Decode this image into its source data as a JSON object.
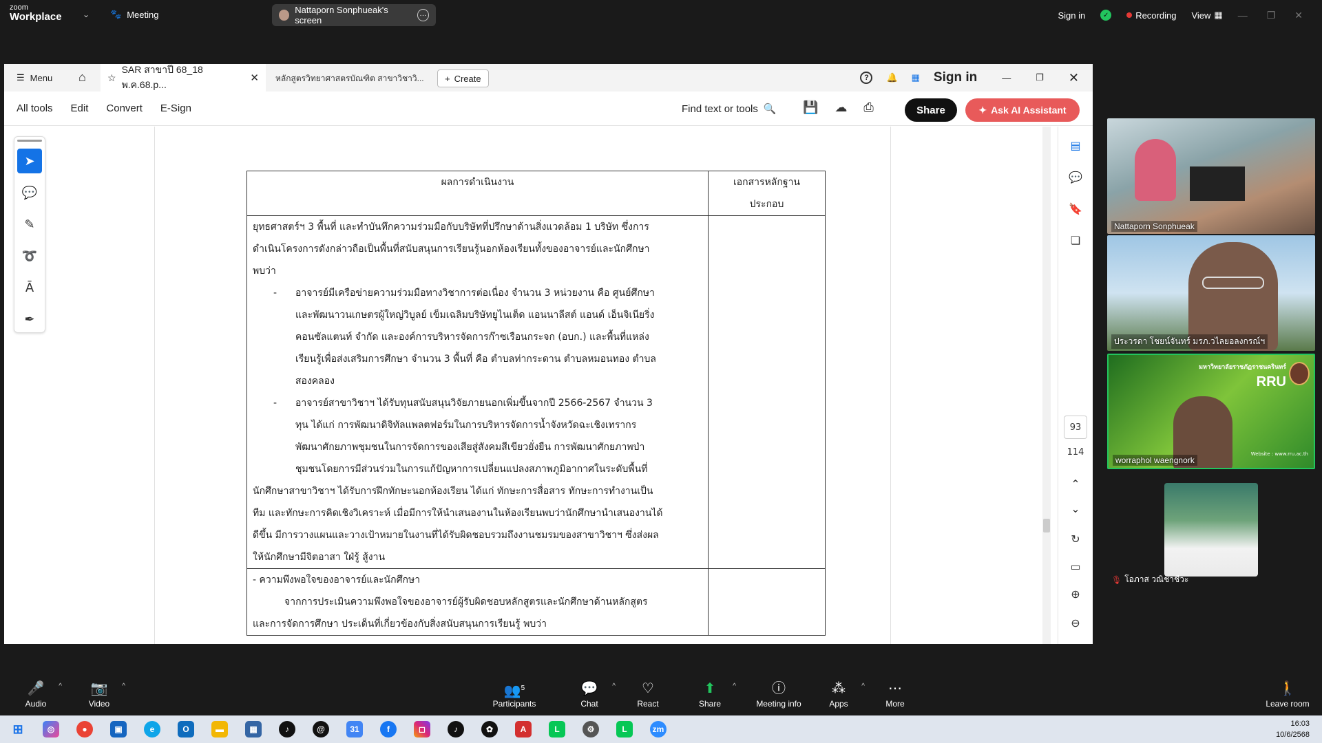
{
  "zoom": {
    "logo_line1": "zoom",
    "logo_line2": "Workplace",
    "meeting_label": "Meeting",
    "screen_share_label": "Nattaporn Sonphueak's screen",
    "sign_in": "Sign in",
    "recording": "Recording",
    "view": "View",
    "recording_color": "#e53935",
    "accent_color": "#22c55e"
  },
  "acrobat": {
    "menu_label": "Menu",
    "active_tab": "SAR สาขาปี 68_18 พ.ค.68.p...",
    "second_tab": "หลักสูตรวิทยาศาสตรบัณฑิต สาขาวิชาวิ...",
    "create_label": "Create",
    "sign_in": "Sign in",
    "toolbar": {
      "all_tools": "All tools",
      "edit": "Edit",
      "convert": "Convert",
      "esign": "E-Sign",
      "find": "Find text or tools",
      "share": "Share",
      "ai_assistant": "Ask AI Assistant"
    },
    "page_current": "93",
    "page_total": "114",
    "ai_color": "#e85a5a",
    "select_color": "#1473e6"
  },
  "document": {
    "header_col1": "ผลการดำเนินงาน",
    "header_col2_line1": "เอกสารหลักฐาน",
    "header_col2_line2": "ประกอบ",
    "para1": [
      "ยุทธศาสตร์ฯ 3 พื้นที่ และทำบันทึกความร่วมมือกับบริษัทที่ปรึกษาด้านสิ่งแวดล้อม 1 บริษัท ซึ่งการ",
      "ดำเนินโครงการดังกล่าวถือเป็นพื้นที่สนับสนุนการเรียนรู้นอกห้องเรียนทั้งของอาจารย์และนักศึกษา",
      "พบว่า"
    ],
    "bullet1": [
      "อาจารย์มีเครือข่ายความร่วมมือทางวิชาการต่อเนื่อง จำนวน 3 หน่วยงาน คือ ศูนย์ศึกษา",
      "และพัฒนาวนเกษตรผู้ใหญ่วิบูลย์ เข็มเฉลิมบริษัทยูไนเต็ด แอนนาลีสต์ แอนด์ เอ็นจิเนียริ่ง",
      "คอนซัลแตนท์ จำกัด และองค์การบริหารจัดการก๊าซเรือนกระจก (อบก.) และพื้นที่แหล่ง",
      "เรียนรู้เพื่อส่งเสริมการศึกษา จำนวน 3 พื้นที่ คือ ตำบลท่ากระดาน ตำบลหมอนทอง ตำบล",
      "สองคลอง"
    ],
    "bullet2": [
      "อาจารย์สาขาวิชาฯ ได้รับทุนสนับสนุนวิจัยภายนอกเพิ่มขึ้นจากปี 2566-2567 จำนวน 3",
      "ทุน ได้แก่ การพัฒนาดิจิทัลแพลตฟอร์มในการบริหารจัดการน้ำจังหวัดฉะเชิงเทรากร",
      "พัฒนาศักยภาพชุมชนในการจัดการของเสียสู่สังคมสีเขียวยั่งยืน การพัฒนาศักยภาพป่า",
      "ชุมชนโดยการมีส่วนร่วมในการแก้ปัญหาการเปลี่ยนแปลงสภาพภูมิอากาศในระดับพื้นที่"
    ],
    "para2": [
      "นักศึกษาสาขาวิชาฯ ได้รับการฝึกทักษะนอกห้องเรียน ได้แก่ ทักษะการสื่อสาร ทักษะการทำงานเป็น",
      "ทีม และทักษะการคิดเชิงวิเคราะห์ เมื่อมีการให้นำเสนองานในห้องเรียนพบว่านักศึกษานำเสนองานได้",
      "ดีขึ้น มีการวางแผนและวางเป้าหมายในงานที่ได้รับผิดชอบรวมถึงงานชมรมของสาขาวิชาฯ ซึ่งส่งผล",
      "ให้นักศึกษามีจิตอาสา ใฝ่รู้ สู้งาน"
    ],
    "section2_title": "- ความพึงพอใจของอาจารย์และนักศึกษา",
    "section2_lines": [
      "จากการประเมินความพึงพอใจของอาจารย์ผู้รับผิดชอบหลักสูตรและนักศึกษาด้านหลักสูตร",
      "และการจัดการศึกษา ประเด็นที่เกี่ยวข้องกับสิ่งสนับสนุนการเรียนรู้ พบว่า"
    ]
  },
  "participants": [
    {
      "name": "Nattaporn Sonphueak"
    },
    {
      "name": "ประวรดา โชยน์จันทร์ มรภ.วไลยอลงกรณ์ฯ"
    },
    {
      "name": "worraphol waengnork",
      "banner_title": "มหาวิทยาลัยราชภัฏราชนครินทร์",
      "banner_logo": "RRU",
      "banner_website": "Website : www.rru.ac.th"
    },
    {
      "name": "โอภาส วณิชาชีวะ"
    }
  ],
  "bottom_bar": {
    "audio": "Audio",
    "video": "Video",
    "participants": "Participants",
    "participants_count": "5",
    "chat": "Chat",
    "react": "React",
    "share": "Share",
    "meeting_info": "Meeting info",
    "apps": "Apps",
    "more": "More",
    "leave": "Leave room",
    "share_color": "#22c55e"
  },
  "taskbar": {
    "time": "16:03",
    "date": "10/6/2568"
  }
}
